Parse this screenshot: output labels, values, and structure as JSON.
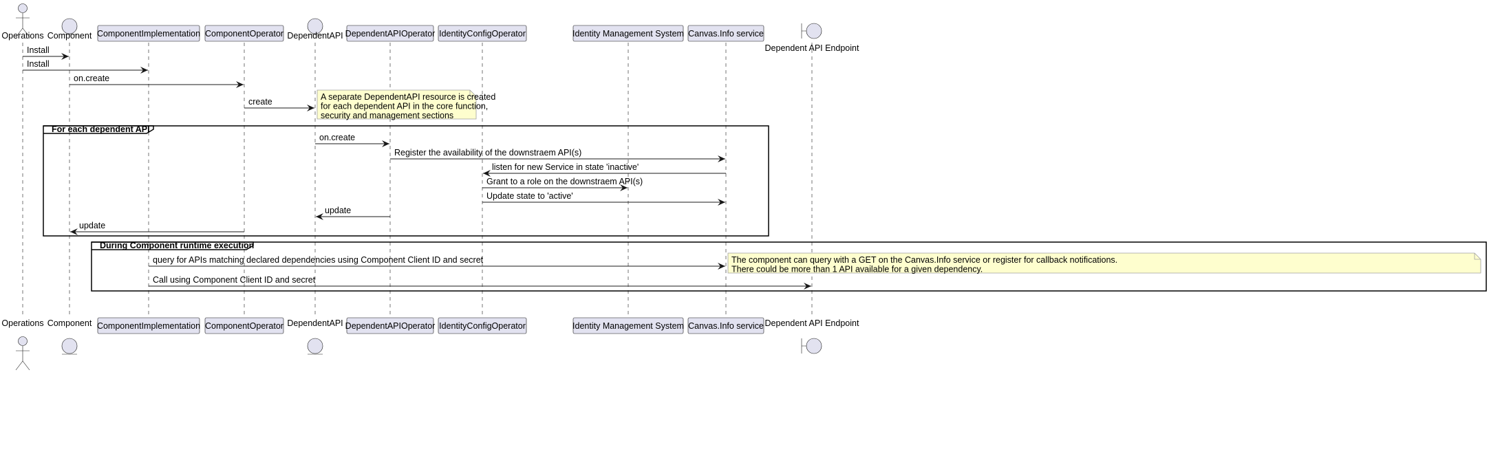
{
  "colors": {
    "participant_fill": "#e2e2f0",
    "participant_stroke": "#181818",
    "note_fill": "#fefece",
    "note_stroke": "#a0a0a0"
  },
  "participants": [
    {
      "name": "Operations",
      "kind": "actor-icon"
    },
    {
      "name": "Component",
      "kind": "entity-icon"
    },
    {
      "name": "ComponentImplementation",
      "kind": "box"
    },
    {
      "name": "ComponentOperator",
      "kind": "box"
    },
    {
      "name": "DependentAPI",
      "kind": "entity-icon"
    },
    {
      "name": "DependentAPIOperator",
      "kind": "box"
    },
    {
      "name": "IdentityConfigOperator",
      "kind": "box"
    },
    {
      "name": "Identity Management System",
      "kind": "box"
    },
    {
      "name": "Canvas.Info service",
      "kind": "box"
    },
    {
      "name": "Dependent API Endpoint",
      "kind": "boundary-icon"
    }
  ],
  "messages": [
    {
      "from": 0,
      "to": 1,
      "label": "Install"
    },
    {
      "from": 0,
      "to": 2,
      "label": "Install"
    },
    {
      "from": 1,
      "to": 3,
      "label": "on.create"
    },
    {
      "from": 3,
      "to": 4,
      "label": "create"
    },
    {
      "from": 4,
      "to": 5,
      "label": "on.create"
    },
    {
      "from": 5,
      "to": 8,
      "label": "Register the availability of the downstraem API(s)"
    },
    {
      "from": 8,
      "to": 6,
      "label": "listen for new Service in state 'inactive'"
    },
    {
      "from": 6,
      "to": 7,
      "label": "Grant to a role on the downstraem API(s)"
    },
    {
      "from": 6,
      "to": 8,
      "label": "Update state to 'active'"
    },
    {
      "from": 5,
      "to": 4,
      "label": "update"
    },
    {
      "from": 3,
      "to": 1,
      "label": "update"
    },
    {
      "from": 2,
      "to": 8,
      "label": "query for APIs matching declared dependencies using Component Client ID and secret"
    },
    {
      "from": 2,
      "to": 9,
      "label": "Call using Component Client ID and secret"
    }
  ],
  "groups": [
    {
      "label": "For each dependent API"
    },
    {
      "label": "During Component runtime execution"
    }
  ],
  "notes": [
    {
      "lines": [
        "A separate DependentAPI resource is created",
        "for each dependent API in the core function,",
        "security and management sections"
      ]
    },
    {
      "lines": [
        "The component can query with a GET on the Canvas.Info service or register for callback notifications.",
        "There could be more than 1 API available for a given dependency."
      ]
    }
  ]
}
